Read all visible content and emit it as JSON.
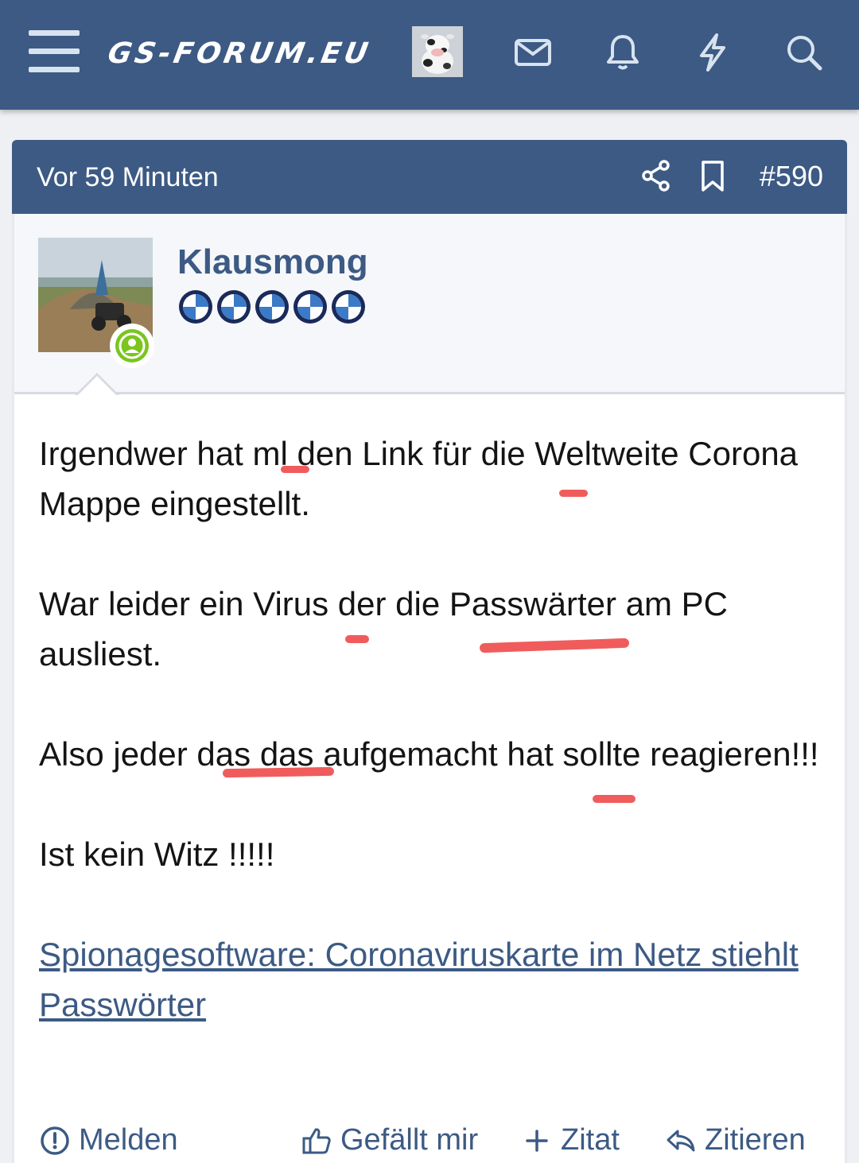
{
  "topbar": {
    "logo": "GS-FORUM.EU",
    "icons": [
      "menu-icon",
      "avatar",
      "envelope-icon",
      "bell-icon",
      "bolt-icon",
      "search-icon"
    ]
  },
  "post": {
    "time": "Vor 59 Minuten",
    "number": "#590",
    "header_icons": [
      "share-icon",
      "bookmark-icon"
    ],
    "author": {
      "name": "Klausmong",
      "status": "online",
      "rank_badges": 5
    },
    "message": {
      "paragraphs": [
        "Irgendwer hat ml den Link für die Weltweite Corona Mappe eingestellt.",
        "War leider ein Virus der die Passwärter am PC ausliest.",
        "Also jeder das das aufgemacht hat sollte reagieren!!!",
        "Ist kein Witz !!!!!"
      ],
      "link_text": "Spionagesoftware: Coronaviruskarte im Netz stiehlt Passwörter"
    },
    "actions": {
      "report": "Melden",
      "like": "Gefällt mir",
      "quote": "Zitat",
      "reply": "Zitieren"
    }
  },
  "colors": {
    "brand": "#3c5a84",
    "online": "#7bc51e",
    "correction_mark": "#ee4a4a"
  }
}
